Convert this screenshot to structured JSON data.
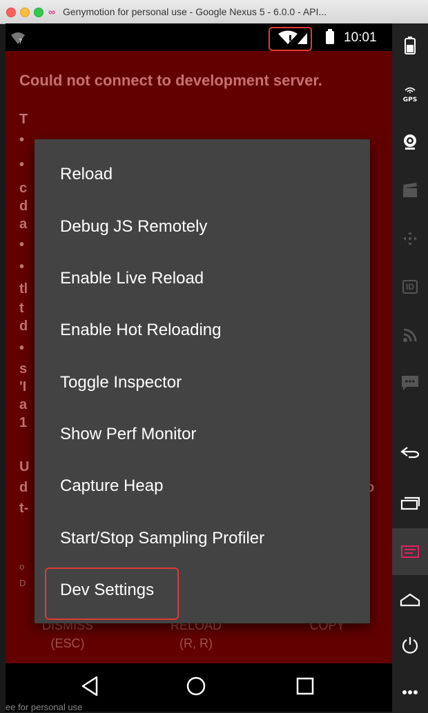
{
  "window": {
    "title": "Genymotion for personal use - Google Nexus 5 - 6.0.0 - API..."
  },
  "status_bar": {
    "time": "10:01"
  },
  "red_box": {
    "title": "Could not connect to development server.",
    "buttons": [
      {
        "line1": "DISMISS",
        "line2": "(ESC)"
      },
      {
        "line1": "RELOAD",
        "line2": "(R, R)"
      },
      {
        "line1": "COPY",
        "line2": ""
      }
    ]
  },
  "dev_menu": {
    "items": [
      {
        "label": "Reload"
      },
      {
        "label": "Debug JS Remotely"
      },
      {
        "label": "Enable Live Reload"
      },
      {
        "label": "Enable Hot Reloading"
      },
      {
        "label": "Toggle Inspector"
      },
      {
        "label": "Show Perf Monitor"
      },
      {
        "label": "Capture Heap"
      },
      {
        "label": "Start/Stop Sampling Profiler"
      },
      {
        "label": "Dev Settings"
      }
    ]
  },
  "sidebar": {
    "gps_label": "GPS",
    "id_label": "ID"
  },
  "watermark": "ee for personal use",
  "colors": {
    "highlight": "#e53935",
    "menu_bg": "#434343",
    "redbox_bg": "#620000"
  }
}
